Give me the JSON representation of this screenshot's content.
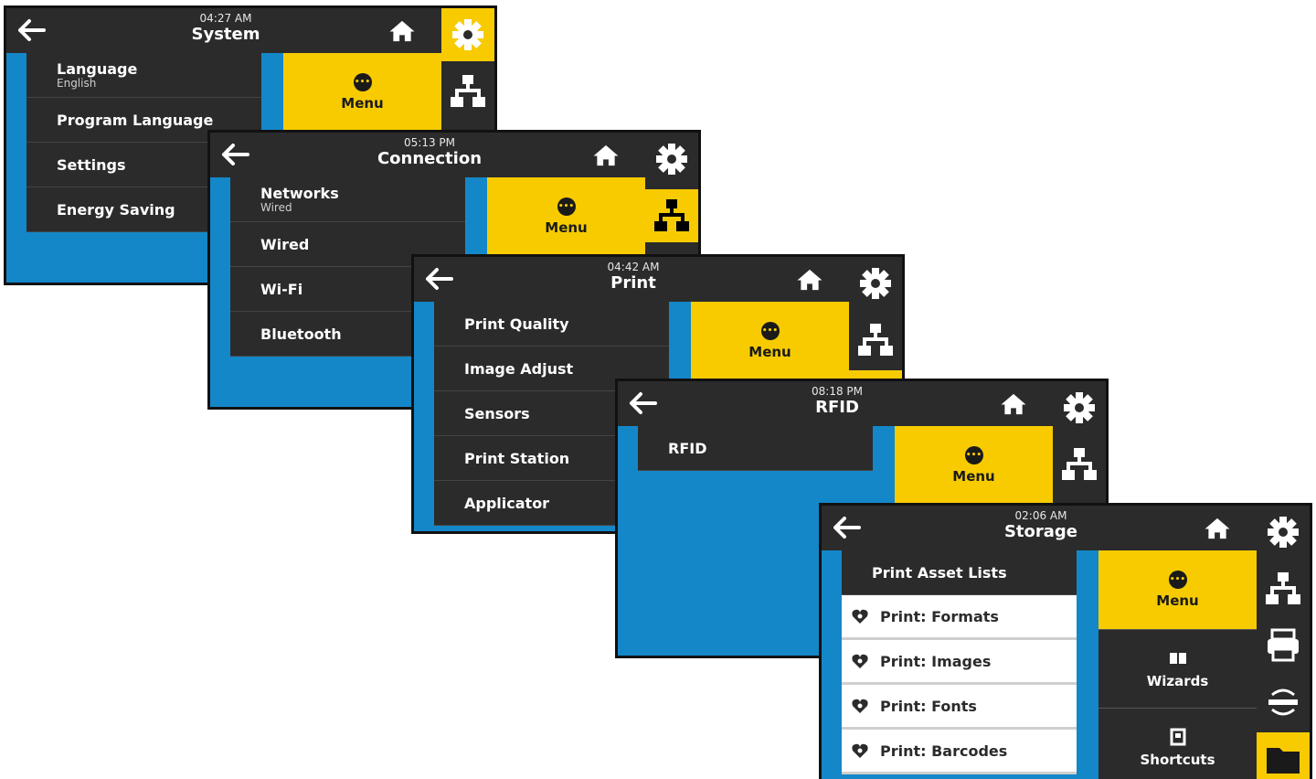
{
  "panels": [
    {
      "time": "04:27 AM",
      "title": "System",
      "menu_label": "Menu",
      "items": [
        {
          "label": "Language",
          "sub": "English"
        },
        {
          "label": "Program Language",
          "sub": ""
        },
        {
          "label": "Settings",
          "sub": ""
        },
        {
          "label": "Energy Saving",
          "sub": ""
        }
      ]
    },
    {
      "time": "05:13 PM",
      "title": "Connection",
      "menu_label": "Menu",
      "items": [
        {
          "label": "Networks",
          "sub": "Wired"
        },
        {
          "label": "Wired",
          "sub": ""
        },
        {
          "label": "Wi-Fi",
          "sub": ""
        },
        {
          "label": "Bluetooth",
          "sub": ""
        }
      ]
    },
    {
      "time": "04:42 AM",
      "title": "Print",
      "menu_label": "Menu",
      "items": [
        {
          "label": "Print Quality",
          "sub": ""
        },
        {
          "label": "Image Adjust",
          "sub": ""
        },
        {
          "label": "Sensors",
          "sub": ""
        },
        {
          "label": "Print Station",
          "sub": ""
        },
        {
          "label": "Applicator",
          "sub": ""
        }
      ]
    },
    {
      "time": "08:18 PM",
      "title": "RFID",
      "menu_label": "Menu",
      "items": [
        {
          "label": "RFID",
          "sub": ""
        }
      ]
    },
    {
      "time": "02:06 AM",
      "title": "Storage",
      "menu_label": "Menu",
      "wizards_label": "Wizards",
      "shortcuts_label": "Shortcuts",
      "items": [
        {
          "label": "Print Asset Lists"
        },
        {
          "label": "Print: Formats"
        },
        {
          "label": "Print: Images"
        },
        {
          "label": "Print: Fonts"
        },
        {
          "label": "Print: Barcodes"
        }
      ]
    }
  ],
  "icons": {
    "back": "arrow-left-icon",
    "home": "home-icon",
    "settings": "gear-icon",
    "network": "network-icon",
    "printer": "printer-icon",
    "rfid": "rfid-icon",
    "storage": "folder-icon",
    "favorite": "heart-icon"
  },
  "colors": {
    "accent": "#f7cb00",
    "dark": "#2b2b2b",
    "blue": "#1487c8"
  }
}
